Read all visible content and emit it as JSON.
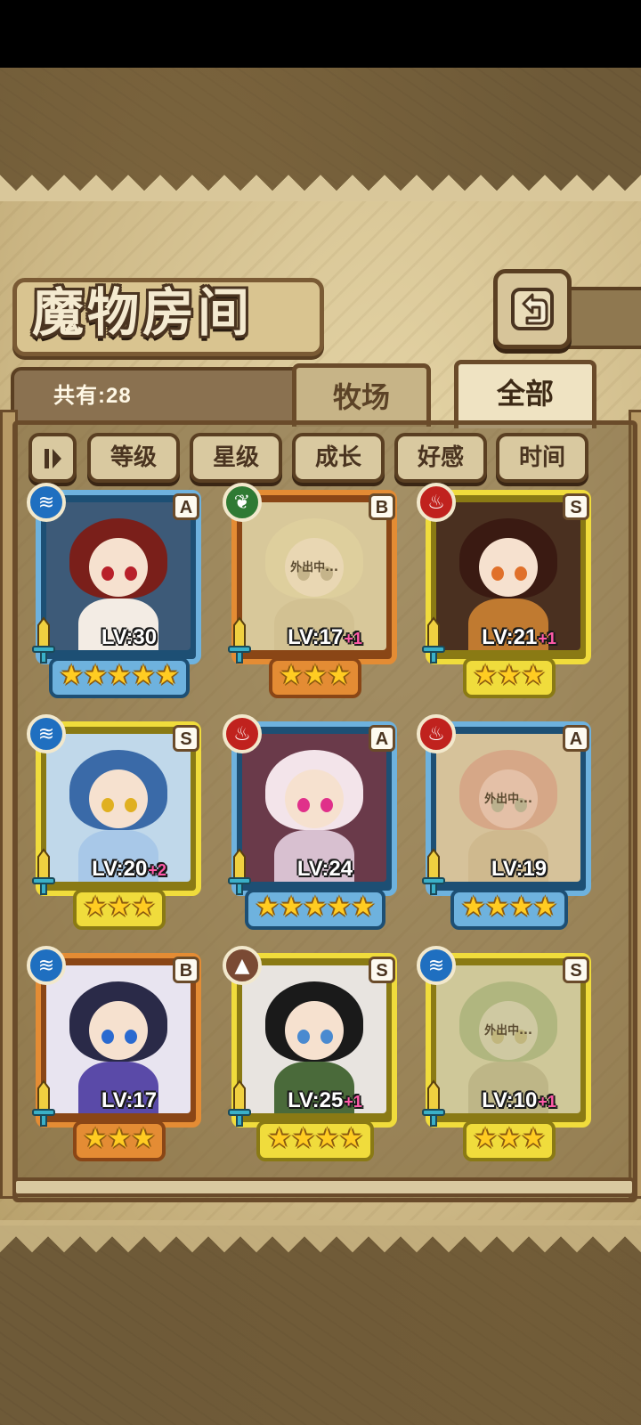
{
  "header": {
    "title": "魔物房间",
    "back_icon": "back-arrow-icon"
  },
  "summary": {
    "count_text": "共有:28"
  },
  "tabs": [
    {
      "label": "牧场",
      "active": false
    },
    {
      "label": "全部",
      "active": true
    }
  ],
  "sort_bar": {
    "order_toggle_icon": "sort-order-icon",
    "buttons": [
      "等级",
      "星级",
      "成长",
      "好感",
      "时间"
    ]
  },
  "status_text_away": "外出中...",
  "colors": {
    "water": "#1f6fc0",
    "nature": "#2f7a34",
    "fire": "#c0221e",
    "earth": "#7a4a34",
    "rank_A_frame": "#5aa0d0",
    "rank_B_frame": "#e08a32",
    "rank_S_frame": "#e8d23a"
  },
  "cards": [
    {
      "element": "water",
      "element_icon": "water-element-icon",
      "rank": "A",
      "level_text": "LV:30",
      "bonus": "",
      "stars": 5,
      "away": false
    },
    {
      "element": "nature",
      "element_icon": "leaf-element-icon",
      "rank": "B",
      "level_text": "LV:17",
      "bonus": "+1",
      "stars": 3,
      "away": true
    },
    {
      "element": "fire",
      "element_icon": "fire-element-icon",
      "rank": "S",
      "level_text": "LV:21",
      "bonus": "+1",
      "stars": 3,
      "away": false
    },
    {
      "element": "water",
      "element_icon": "water-element-icon",
      "rank": "S",
      "level_text": "LV:20",
      "bonus": "+2",
      "stars": 3,
      "away": false
    },
    {
      "element": "fire",
      "element_icon": "fire-element-icon",
      "rank": "A",
      "level_text": "LV:24",
      "bonus": "",
      "stars": 5,
      "away": false
    },
    {
      "element": "fire",
      "element_icon": "fire-element-icon",
      "rank": "A",
      "level_text": "LV:19",
      "bonus": "",
      "stars": 4,
      "away": true
    },
    {
      "element": "water",
      "element_icon": "water-element-icon",
      "rank": "B",
      "level_text": "LV:17",
      "bonus": "",
      "stars": 3,
      "away": false
    },
    {
      "element": "earth",
      "element_icon": "earth-element-icon",
      "rank": "S",
      "level_text": "LV:25",
      "bonus": "+1",
      "stars": 4,
      "away": false
    },
    {
      "element": "water",
      "element_icon": "water-element-icon",
      "rank": "S",
      "level_text": "LV:10",
      "bonus": "+1",
      "stars": 3,
      "away": true
    }
  ]
}
